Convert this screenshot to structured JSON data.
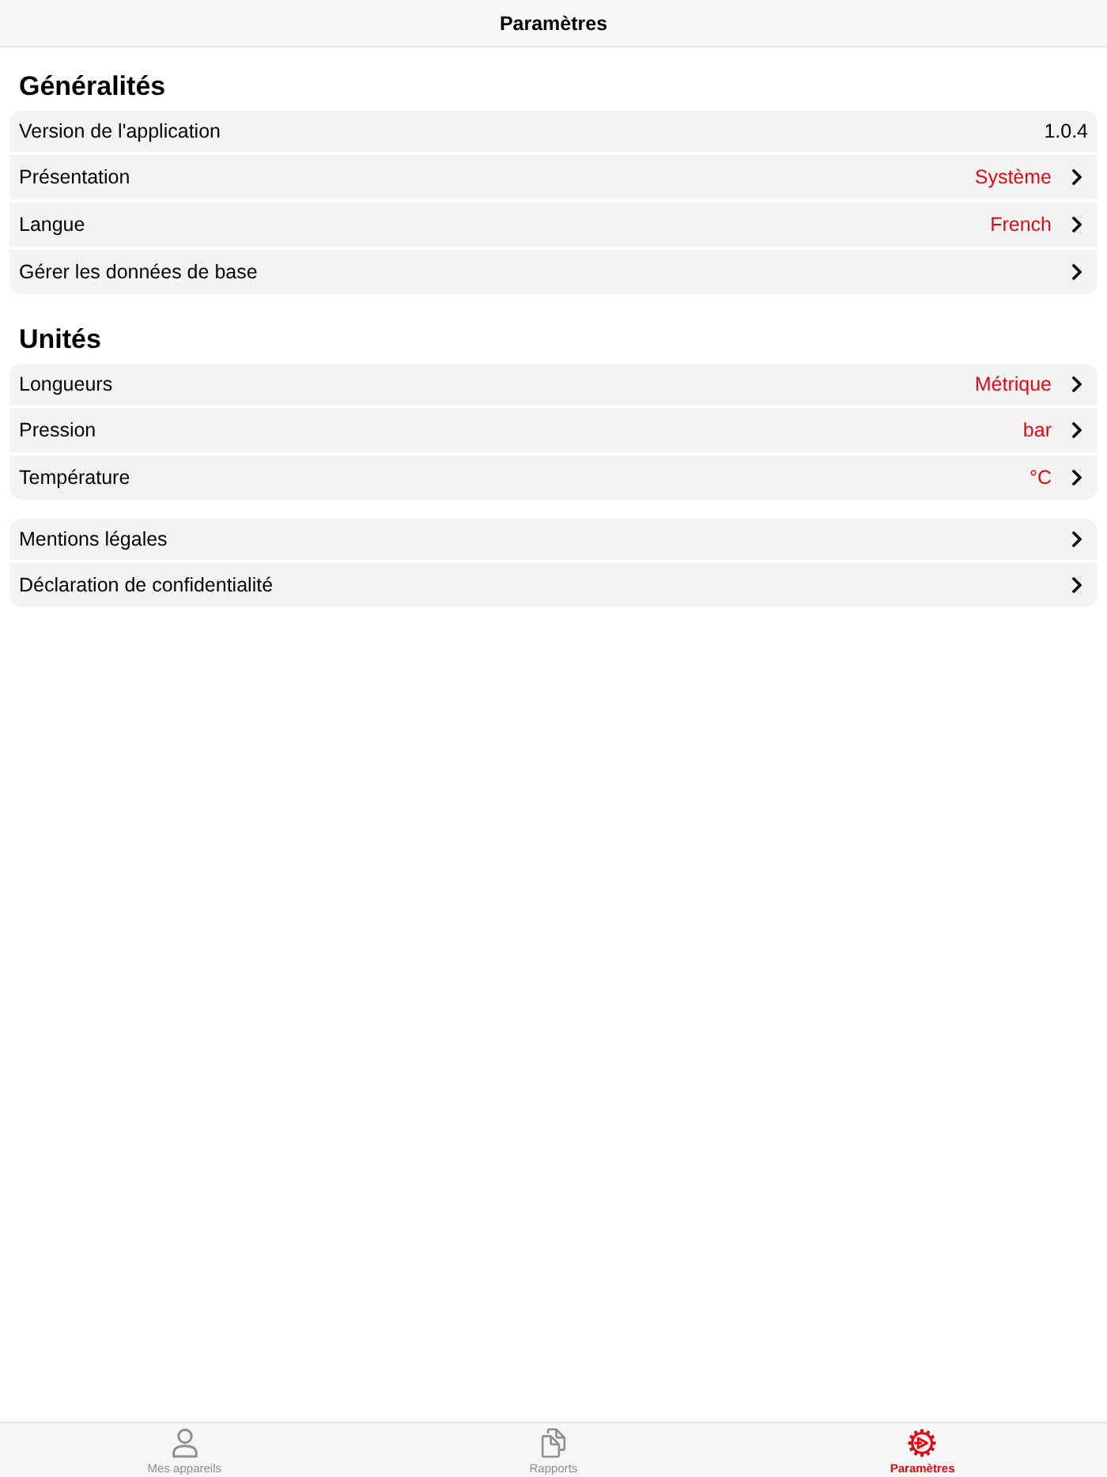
{
  "header": {
    "title": "Paramètres"
  },
  "sections": [
    {
      "heading": "Généralités",
      "rows": [
        {
          "kind": "info",
          "label": "Version de l'application",
          "value": "1.0.4"
        },
        {
          "kind": "link",
          "label": "Présentation",
          "value": "Système"
        },
        {
          "kind": "link",
          "label": "Langue",
          "value": "French"
        },
        {
          "kind": "link",
          "label": "Gérer les données de base"
        }
      ]
    },
    {
      "heading": "Unités",
      "rows": [
        {
          "kind": "link",
          "label": "Longueurs",
          "value": "Métrique"
        },
        {
          "kind": "link",
          "label": "Pression",
          "value": "bar"
        },
        {
          "kind": "link",
          "label": "Température",
          "value": "°C"
        }
      ]
    },
    {
      "rows": [
        {
          "kind": "link",
          "label": "Mentions légales"
        },
        {
          "kind": "link",
          "label": "Déclaration de confidentialité"
        }
      ]
    }
  ],
  "tab_bar": {
    "tabs": [
      {
        "label": "Mes appareils",
        "selected": false
      },
      {
        "label": "Rapports",
        "selected": false
      },
      {
        "label": "Paramètres",
        "selected": true
      }
    ]
  }
}
